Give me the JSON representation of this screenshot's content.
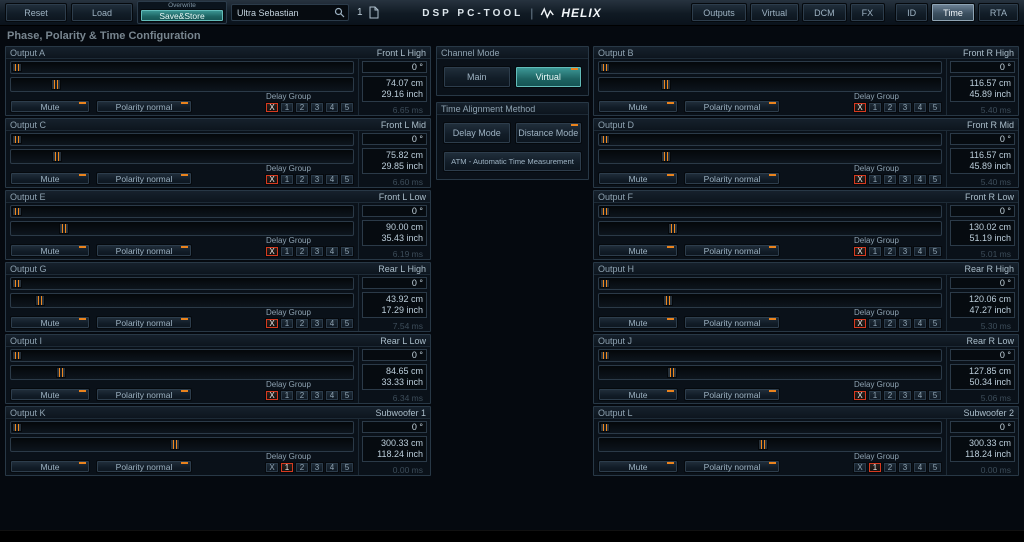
{
  "topbar": {
    "reset_label": "Reset",
    "load_label": "Load",
    "overwrite_label": "Overwrite",
    "save_store_label": "Save&Store",
    "preset_name": "Ultra Sebastian",
    "device_number": "1",
    "logo_left": "DSP PC-TOOL",
    "logo_sep": "|",
    "logo_brand": "HELIX",
    "nav": [
      {
        "label": "Outputs",
        "active": false
      },
      {
        "label": "Virtual",
        "active": false
      },
      {
        "label": "DCM",
        "active": false
      },
      {
        "label": "FX",
        "active": false
      },
      {
        "label": "ID",
        "active": false
      },
      {
        "label": "Time",
        "active": true
      },
      {
        "label": "RTA",
        "active": false
      }
    ]
  },
  "page_title": "Phase, Polarity & Time Configuration",
  "channel_mode": {
    "title": "Channel Mode",
    "main_label": "Main",
    "virtual_label": "Virtual",
    "selected": "Virtual"
  },
  "time_alignment": {
    "title": "Time Alignment Method",
    "delay_label": "Delay Mode",
    "distance_label": "Distance Mode",
    "selected": "Distance Mode",
    "atm_label": "ATM - Automatic Time Measurement"
  },
  "labels": {
    "mute": "Mute",
    "polarity": "Polarity normal",
    "delay_group": "Delay Group"
  },
  "delay_group_options": [
    "X",
    "1",
    "2",
    "3",
    "4",
    "5"
  ],
  "accent_colors": {
    "orange": "#ea831d",
    "teal": "#2d8a88",
    "selected_red": "#d63a20"
  },
  "outputs": {
    "left": [
      {
        "id": "Output A",
        "channel": "Front L High",
        "phase": "0 °",
        "phase_percent": 0,
        "distance_cm": "74.07 cm",
        "distance_inch": "29.16 inch",
        "delay_ms": "6.65 ms",
        "distance_percent": 11.8,
        "delay_group": "X"
      },
      {
        "id": "Output C",
        "channel": "Front L Mid",
        "phase": "0 °",
        "phase_percent": 0,
        "distance_cm": "75.82 cm",
        "distance_inch": "29.85 inch",
        "delay_ms": "6.60 ms",
        "distance_percent": 12.0,
        "delay_group": "X"
      },
      {
        "id": "Output E",
        "channel": "Front L Low",
        "phase": "0 °",
        "phase_percent": 0,
        "distance_cm": "90.00 cm",
        "distance_inch": "35.43 inch",
        "delay_ms": "6.19 ms",
        "distance_percent": 14.3,
        "delay_group": "X"
      },
      {
        "id": "Output G",
        "channel": "Rear L High",
        "phase": "0 °",
        "phase_percent": 0,
        "distance_cm": "43.92 cm",
        "distance_inch": "17.29 inch",
        "delay_ms": "7.54 ms",
        "distance_percent": 7.0,
        "delay_group": "X"
      },
      {
        "id": "Output I",
        "channel": "Rear L Low",
        "phase": "0 °",
        "phase_percent": 0,
        "distance_cm": "84.65 cm",
        "distance_inch": "33.33 inch",
        "delay_ms": "6.34 ms",
        "distance_percent": 13.4,
        "delay_group": "X"
      },
      {
        "id": "Output K",
        "channel": "Subwoofer 1",
        "phase": "0 °",
        "phase_percent": 0,
        "distance_cm": "300.33 cm",
        "distance_inch": "118.24 inch",
        "delay_ms": "0.00 ms",
        "distance_percent": 47.7,
        "delay_group": "1"
      }
    ],
    "right": [
      {
        "id": "Output B",
        "channel": "Front R High",
        "phase": "0 °",
        "phase_percent": 0,
        "distance_cm": "116.57 cm",
        "distance_inch": "45.89 inch",
        "delay_ms": "5.40 ms",
        "distance_percent": 18.5,
        "delay_group": "X"
      },
      {
        "id": "Output D",
        "channel": "Front R Mid",
        "phase": "0 °",
        "phase_percent": 0,
        "distance_cm": "116.57 cm",
        "distance_inch": "45.89 inch",
        "delay_ms": "5.40 ms",
        "distance_percent": 18.5,
        "delay_group": "X"
      },
      {
        "id": "Output F",
        "channel": "Front R Low",
        "phase": "0 °",
        "phase_percent": 0,
        "distance_cm": "130.02 cm",
        "distance_inch": "51.19 inch",
        "delay_ms": "5.01 ms",
        "distance_percent": 20.6,
        "delay_group": "X"
      },
      {
        "id": "Output H",
        "channel": "Rear R High",
        "phase": "0 °",
        "phase_percent": 0,
        "distance_cm": "120.06 cm",
        "distance_inch": "47.27 inch",
        "delay_ms": "5.30 ms",
        "distance_percent": 19.1,
        "delay_group": "X"
      },
      {
        "id": "Output J",
        "channel": "Rear R Low",
        "phase": "0 °",
        "phase_percent": 0,
        "distance_cm": "127.85 cm",
        "distance_inch": "50.34 inch",
        "delay_ms": "5.06 ms",
        "distance_percent": 20.3,
        "delay_group": "X"
      },
      {
        "id": "Output L",
        "channel": "Subwoofer 2",
        "phase": "0 °",
        "phase_percent": 0,
        "distance_cm": "300.33 cm",
        "distance_inch": "118.24 inch",
        "delay_ms": "0.00 ms",
        "distance_percent": 47.7,
        "delay_group": "1"
      }
    ]
  }
}
